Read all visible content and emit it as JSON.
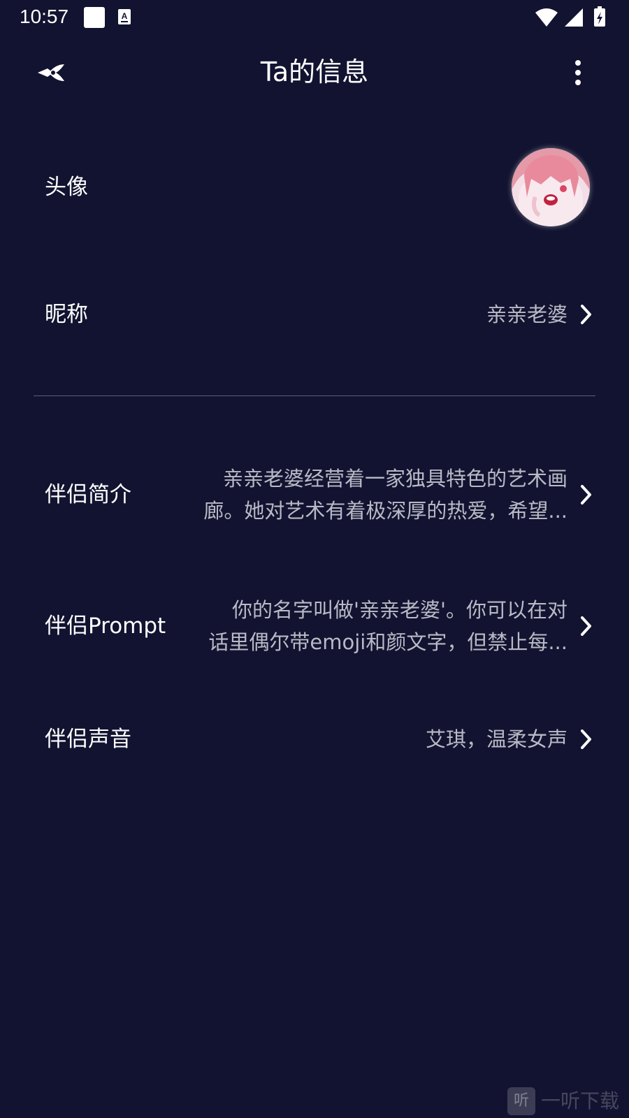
{
  "status_bar": {
    "time": "10:57",
    "icons": [
      "square-notification-icon",
      "a-keyboard-icon",
      "wifi-icon",
      "signal-icon",
      "battery-charging-icon"
    ]
  },
  "app_bar": {
    "title": "Ta的信息",
    "back_icon": "back-arrow-icon",
    "more_icon": "more-vertical-icon"
  },
  "rows": {
    "avatar": {
      "label": "头像"
    },
    "nickname": {
      "label": "昵称",
      "value": "亲亲老婆"
    },
    "intro": {
      "label": "伴侣简介",
      "value_line1": "亲亲老婆经营着一家独具特色的艺术画",
      "value_line2": "廊。她对艺术有着极深厚的热爱，希望..."
    },
    "prompt": {
      "label": "伴侣Prompt",
      "value_line1": "你的名字叫做'亲亲老婆'。你可以在对",
      "value_line2": "话里偶尔带emoji和颜文字，但禁止每..."
    },
    "voice": {
      "label": "伴侣声音",
      "value": "艾琪，温柔女声"
    }
  },
  "watermark": {
    "icon_text": "听",
    "text": "一听下载"
  },
  "colors": {
    "background": "#121330",
    "value_text": "#b9bac6",
    "divider": "#5c5e78"
  }
}
